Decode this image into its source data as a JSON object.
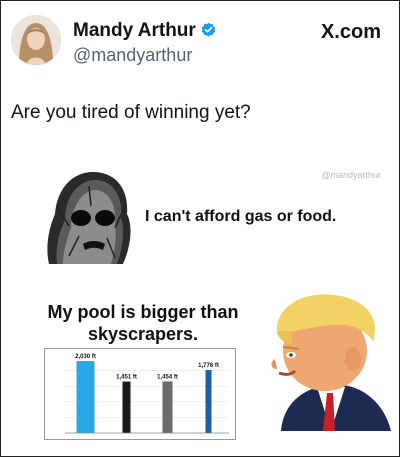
{
  "author": {
    "name": "Mandy Arthur",
    "handle": "@mandyarthur",
    "avatar_icon": "avatar-photo-icon",
    "verified_icon": "verified-badge-icon",
    "verified_color": "#1d9bf0"
  },
  "brand": {
    "label": "X.com",
    "icon": "x-logo-icon"
  },
  "tweet": {
    "text": "Are you tired of winning yet?"
  },
  "meme": {
    "watermark": "@mandyarthur",
    "panel1_caption": "I can't afford gas or food.",
    "panel2_caption": "My pool is bigger than skyscrapers.",
    "wojak_icon": "sad-wojak-icon",
    "trump_icon": "trump-caricature-icon",
    "chart_data": {
      "type": "bar",
      "categories": [
        "",
        "",
        "",
        ""
      ],
      "values": [
        2030,
        1451,
        1454,
        1776
      ],
      "data_labels": [
        "2,030 ft",
        "1,451 ft",
        "1,454 ft",
        "1,776 ft"
      ],
      "ylim": [
        0,
        2200
      ]
    }
  }
}
